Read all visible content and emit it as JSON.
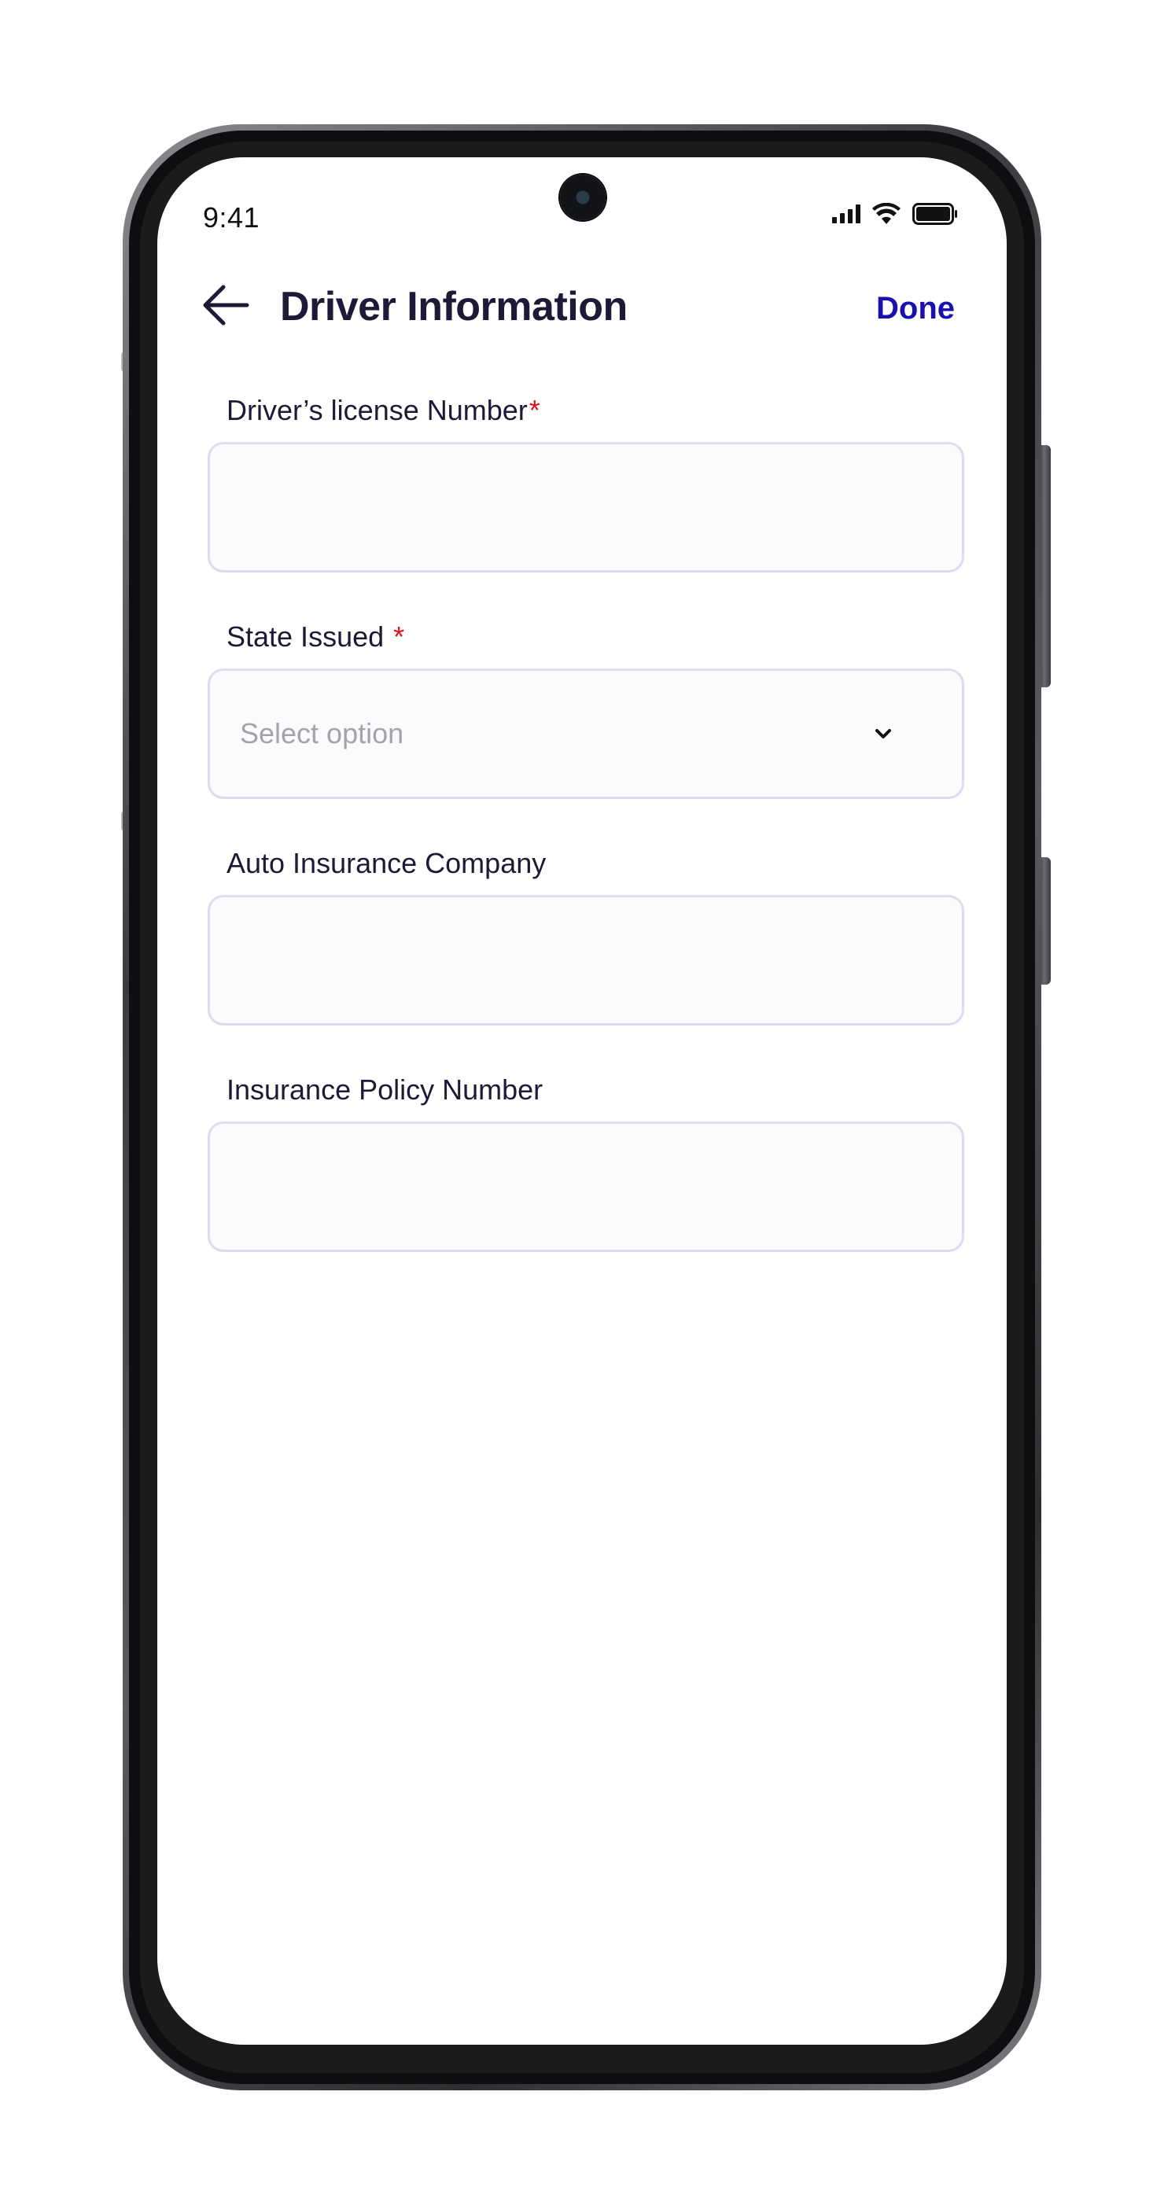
{
  "status_bar": {
    "time": "9:41"
  },
  "header": {
    "title": "Driver Information",
    "done_label": "Done",
    "back_icon": "arrow-left-icon"
  },
  "form": {
    "fields": [
      {
        "label": "Driver’s license Number",
        "required_mark": "*",
        "value": "",
        "placeholder": ""
      },
      {
        "label": "State Issued",
        "required_mark": "*",
        "selected": "Select option",
        "icon": "chevron-down-icon"
      },
      {
        "label": "Auto Insurance Company",
        "value": "",
        "placeholder": ""
      },
      {
        "label": "Insurance Policy Number",
        "value": "",
        "placeholder": ""
      }
    ]
  },
  "colors": {
    "title": "#1c1a36",
    "accent": "#1a10b0",
    "required": "#d8141f",
    "input_border": "#dddbf3",
    "input_bg": "#fbfbfe",
    "placeholder": "#a3a3ab"
  }
}
